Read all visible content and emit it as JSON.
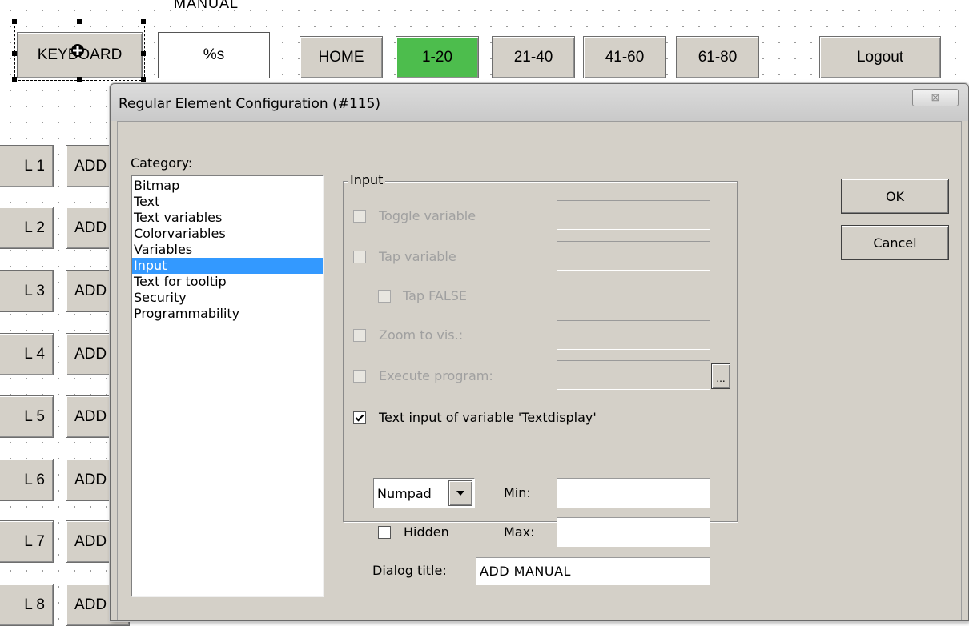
{
  "canvas": {
    "label_manual": "MANUAL",
    "keyboard_btn": "KEYBOARD",
    "text_display": "%s",
    "nav": {
      "home": "HOME",
      "r1": "1-20",
      "r2": "21-40",
      "r3": "41-60",
      "r4": "61-80",
      "logout": "Logout"
    },
    "left_labels": [
      "L 1",
      "L 2",
      "L 3",
      "L 4",
      "L 5",
      "L 6",
      "L 7",
      "L 8"
    ],
    "add_label": "ADD",
    "colors": {
      "active_nav": "#4dbd4d",
      "button_face": "#d4d0c8"
    }
  },
  "dialog": {
    "title": "Regular Element Configuration (#115)",
    "close_glyph": "⊠",
    "category_label": "Category:",
    "categories": [
      "Bitmap",
      "Text",
      "Text variables",
      "Colorvariables",
      "Variables",
      "Input",
      "Text for tooltip",
      "Security",
      "Programmability"
    ],
    "selected_category": "Input",
    "group_title": "Input",
    "options": {
      "toggle_variable": {
        "label": "Toggle variable",
        "checked": false,
        "enabled": false,
        "value": ""
      },
      "tap_variable": {
        "label": "Tap variable",
        "checked": false,
        "enabled": false,
        "value": ""
      },
      "tap_false": {
        "label": "Tap FALSE",
        "checked": false,
        "enabled": false
      },
      "zoom_to_vis": {
        "label": "Zoom to vis.:",
        "checked": false,
        "enabled": false,
        "value": ""
      },
      "execute_program": {
        "label": "Execute program:",
        "checked": false,
        "enabled": false,
        "value": "",
        "browse": "..."
      },
      "text_input": {
        "label": "Text input of variable 'Textdisplay'",
        "checked": true,
        "enabled": true
      }
    },
    "input_type": "Numpad",
    "min_label": "Min:",
    "min_value": "",
    "hidden_label": "Hidden",
    "hidden_checked": false,
    "max_label": "Max:",
    "max_value": "",
    "dialog_title_label": "Dialog title:",
    "dialog_title_value": "ADD MANUAL",
    "ok_label": "OK",
    "cancel_label": "Cancel",
    "selection_color": "#3399ff"
  }
}
